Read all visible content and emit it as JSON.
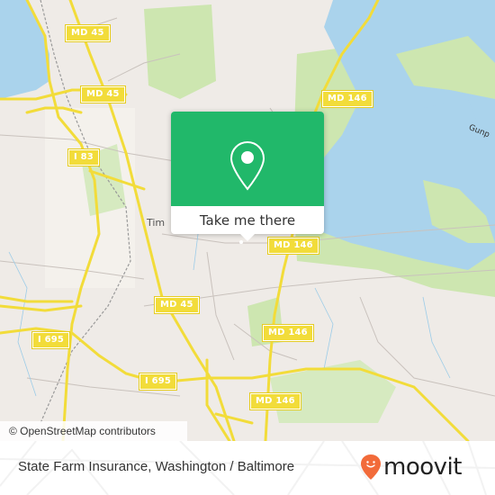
{
  "map": {
    "colors": {
      "land": "#efebe7",
      "water": "#aad3ec",
      "park": "#cde6b0",
      "road": "#f2dc3a",
      "minor_road": "#c9c2bd",
      "accent": "#21b86a"
    },
    "road_shields": [
      {
        "label": "MD 45"
      },
      {
        "label": "MD 45"
      },
      {
        "label": "I 83"
      },
      {
        "label": "MD 146"
      },
      {
        "label": "MD 146"
      },
      {
        "label": "MD 45"
      },
      {
        "label": "MD 146"
      },
      {
        "label": "I 695"
      },
      {
        "label": "I 695"
      },
      {
        "label": "MD 146"
      },
      {
        "label": "146"
      }
    ],
    "place_labels": {
      "town": "Tim",
      "water": "Gunp"
    }
  },
  "popup": {
    "icon": "map-pin-icon",
    "button_label": "Take me there"
  },
  "attribution": "© OpenStreetMap contributors",
  "footer": {
    "title": "State Farm Insurance, Washington / Baltimore",
    "logo_text": "moovit",
    "logo_icon": "moovit-pin-smile-icon",
    "logo_color": "#f26b3a"
  }
}
